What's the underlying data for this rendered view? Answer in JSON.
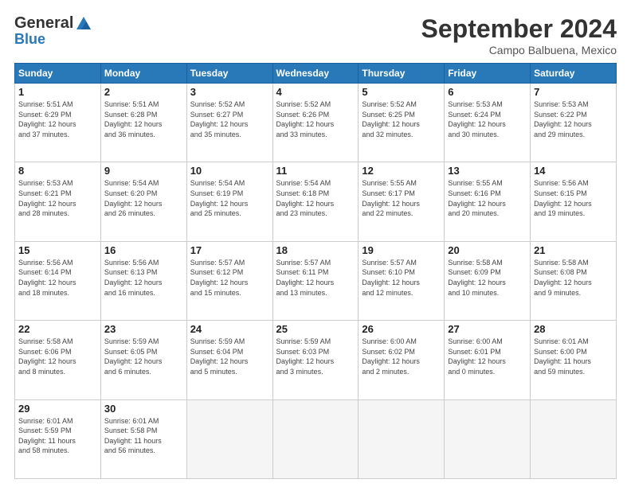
{
  "header": {
    "logo_general": "General",
    "logo_blue": "Blue",
    "month_title": "September 2024",
    "location": "Campo Balbuena, Mexico"
  },
  "calendar": {
    "days_of_week": [
      "Sunday",
      "Monday",
      "Tuesday",
      "Wednesday",
      "Thursday",
      "Friday",
      "Saturday"
    ],
    "weeks": [
      [
        {
          "day": "",
          "empty": true
        },
        {
          "day": "",
          "empty": true
        },
        {
          "day": "",
          "empty": true
        },
        {
          "day": "",
          "empty": true
        },
        {
          "day": "",
          "empty": true
        },
        {
          "day": "",
          "empty": true
        },
        {
          "day": "",
          "empty": true
        }
      ],
      [
        {
          "day": "1",
          "info": "Sunrise: 5:51 AM\nSunset: 6:29 PM\nDaylight: 12 hours\nand 37 minutes."
        },
        {
          "day": "2",
          "info": "Sunrise: 5:51 AM\nSunset: 6:28 PM\nDaylight: 12 hours\nand 36 minutes."
        },
        {
          "day": "3",
          "info": "Sunrise: 5:52 AM\nSunset: 6:27 PM\nDaylight: 12 hours\nand 35 minutes."
        },
        {
          "day": "4",
          "info": "Sunrise: 5:52 AM\nSunset: 6:26 PM\nDaylight: 12 hours\nand 33 minutes."
        },
        {
          "day": "5",
          "info": "Sunrise: 5:52 AM\nSunset: 6:25 PM\nDaylight: 12 hours\nand 32 minutes."
        },
        {
          "day": "6",
          "info": "Sunrise: 5:53 AM\nSunset: 6:24 PM\nDaylight: 12 hours\nand 30 minutes."
        },
        {
          "day": "7",
          "info": "Sunrise: 5:53 AM\nSunset: 6:22 PM\nDaylight: 12 hours\nand 29 minutes."
        }
      ],
      [
        {
          "day": "8",
          "info": "Sunrise: 5:53 AM\nSunset: 6:21 PM\nDaylight: 12 hours\nand 28 minutes."
        },
        {
          "day": "9",
          "info": "Sunrise: 5:54 AM\nSunset: 6:20 PM\nDaylight: 12 hours\nand 26 minutes."
        },
        {
          "day": "10",
          "info": "Sunrise: 5:54 AM\nSunset: 6:19 PM\nDaylight: 12 hours\nand 25 minutes."
        },
        {
          "day": "11",
          "info": "Sunrise: 5:54 AM\nSunset: 6:18 PM\nDaylight: 12 hours\nand 23 minutes."
        },
        {
          "day": "12",
          "info": "Sunrise: 5:55 AM\nSunset: 6:17 PM\nDaylight: 12 hours\nand 22 minutes."
        },
        {
          "day": "13",
          "info": "Sunrise: 5:55 AM\nSunset: 6:16 PM\nDaylight: 12 hours\nand 20 minutes."
        },
        {
          "day": "14",
          "info": "Sunrise: 5:56 AM\nSunset: 6:15 PM\nDaylight: 12 hours\nand 19 minutes."
        }
      ],
      [
        {
          "day": "15",
          "info": "Sunrise: 5:56 AM\nSunset: 6:14 PM\nDaylight: 12 hours\nand 18 minutes."
        },
        {
          "day": "16",
          "info": "Sunrise: 5:56 AM\nSunset: 6:13 PM\nDaylight: 12 hours\nand 16 minutes."
        },
        {
          "day": "17",
          "info": "Sunrise: 5:57 AM\nSunset: 6:12 PM\nDaylight: 12 hours\nand 15 minutes."
        },
        {
          "day": "18",
          "info": "Sunrise: 5:57 AM\nSunset: 6:11 PM\nDaylight: 12 hours\nand 13 minutes."
        },
        {
          "day": "19",
          "info": "Sunrise: 5:57 AM\nSunset: 6:10 PM\nDaylight: 12 hours\nand 12 minutes."
        },
        {
          "day": "20",
          "info": "Sunrise: 5:58 AM\nSunset: 6:09 PM\nDaylight: 12 hours\nand 10 minutes."
        },
        {
          "day": "21",
          "info": "Sunrise: 5:58 AM\nSunset: 6:08 PM\nDaylight: 12 hours\nand 9 minutes."
        }
      ],
      [
        {
          "day": "22",
          "info": "Sunrise: 5:58 AM\nSunset: 6:06 PM\nDaylight: 12 hours\nand 8 minutes."
        },
        {
          "day": "23",
          "info": "Sunrise: 5:59 AM\nSunset: 6:05 PM\nDaylight: 12 hours\nand 6 minutes."
        },
        {
          "day": "24",
          "info": "Sunrise: 5:59 AM\nSunset: 6:04 PM\nDaylight: 12 hours\nand 5 minutes."
        },
        {
          "day": "25",
          "info": "Sunrise: 5:59 AM\nSunset: 6:03 PM\nDaylight: 12 hours\nand 3 minutes."
        },
        {
          "day": "26",
          "info": "Sunrise: 6:00 AM\nSunset: 6:02 PM\nDaylight: 12 hours\nand 2 minutes."
        },
        {
          "day": "27",
          "info": "Sunrise: 6:00 AM\nSunset: 6:01 PM\nDaylight: 12 hours\nand 0 minutes."
        },
        {
          "day": "28",
          "info": "Sunrise: 6:01 AM\nSunset: 6:00 PM\nDaylight: 11 hours\nand 59 minutes."
        }
      ],
      [
        {
          "day": "29",
          "info": "Sunrise: 6:01 AM\nSunset: 5:59 PM\nDaylight: 11 hours\nand 58 minutes."
        },
        {
          "day": "30",
          "info": "Sunrise: 6:01 AM\nSunset: 5:58 PM\nDaylight: 11 hours\nand 56 minutes."
        },
        {
          "day": "",
          "empty": true
        },
        {
          "day": "",
          "empty": true
        },
        {
          "day": "",
          "empty": true
        },
        {
          "day": "",
          "empty": true
        },
        {
          "day": "",
          "empty": true
        }
      ]
    ]
  }
}
